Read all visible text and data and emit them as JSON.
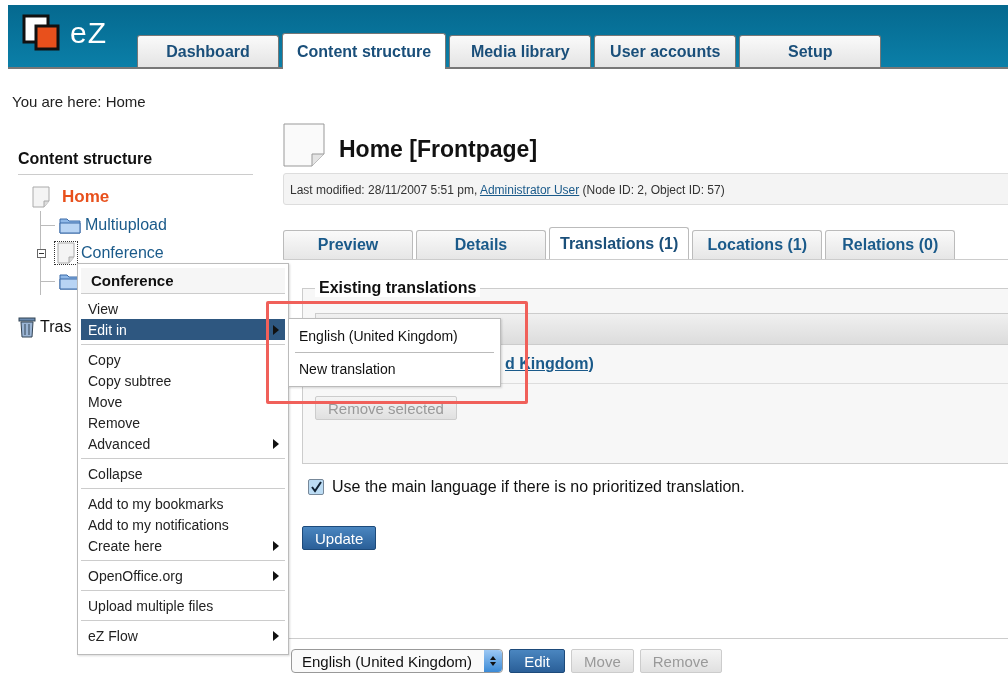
{
  "header": {
    "logo_text": "eZ",
    "tabs": [
      {
        "label": "Dashboard",
        "selected": false
      },
      {
        "label": "Content structure",
        "selected": true
      },
      {
        "label": "Media library",
        "selected": false
      },
      {
        "label": "User accounts",
        "selected": false
      },
      {
        "label": "Setup",
        "selected": false
      }
    ]
  },
  "breadcrumb": "You are here: Home",
  "sidebar": {
    "title": "Content structure",
    "tree": [
      {
        "label": "Home",
        "kind": "page",
        "selected": true,
        "children": [
          {
            "label": "Multiupload",
            "kind": "folder",
            "selected": false
          },
          {
            "label": "Conference",
            "kind": "page",
            "selected": false,
            "expanded": true
          },
          {
            "kind": "folder"
          }
        ]
      }
    ],
    "trash": "Tras"
  },
  "context_menu": {
    "title": "Conference",
    "sections": [
      [
        {
          "label": "View",
          "submenu": false,
          "highlighted": false
        },
        {
          "label": "Edit in",
          "submenu": true,
          "highlighted": true
        }
      ],
      [
        {
          "label": "Copy",
          "submenu": false,
          "highlighted": false
        },
        {
          "label": "Copy subtree",
          "submenu": false,
          "highlighted": false
        },
        {
          "label": "Move",
          "submenu": false,
          "highlighted": false
        },
        {
          "label": "Remove",
          "submenu": false,
          "highlighted": false
        },
        {
          "label": "Advanced",
          "submenu": true,
          "highlighted": false
        }
      ],
      [
        {
          "label": "Collapse",
          "submenu": false,
          "highlighted": false
        }
      ],
      [
        {
          "label": "Add to my bookmarks",
          "submenu": false,
          "highlighted": false
        },
        {
          "label": "Add to my notifications",
          "submenu": false,
          "highlighted": false
        },
        {
          "label": "Create here",
          "submenu": true,
          "highlighted": false
        }
      ],
      [
        {
          "label": "OpenOffice.org",
          "submenu": true,
          "highlighted": false
        }
      ],
      [
        {
          "label": "Upload multiple files",
          "submenu": false,
          "highlighted": false
        }
      ],
      [
        {
          "label": "eZ Flow",
          "submenu": true,
          "highlighted": false
        }
      ]
    ]
  },
  "submenu": {
    "items": [
      "English (United Kingdom)",
      "New translation"
    ]
  },
  "content": {
    "title": "Home [Frontpage]",
    "meta": {
      "before": "Last modified: 28/11/2007 5:51 pm, ",
      "link": "Administrator User",
      "after": " (Node ID: 2, Object ID: 57)"
    },
    "tabs": [
      {
        "label": "Preview",
        "selected": false
      },
      {
        "label": "Details",
        "selected": false
      },
      {
        "label": "Translations (1)",
        "selected": true
      },
      {
        "label": "Locations (1)",
        "selected": false
      },
      {
        "label": "Relations (0)",
        "selected": false
      }
    ],
    "translations": {
      "legend": "Existing translations",
      "link_fragment": "d Kingdom)",
      "remove_button": {
        "label": "Remove selected",
        "disabled": true
      }
    },
    "fallback": {
      "label": "Use the main language if there is no prioritized translation.",
      "checked": true
    },
    "update_button": "Update",
    "bottom_bar": {
      "language": "English (United Kingdom)",
      "buttons": [
        {
          "label": "Edit",
          "disabled": false
        },
        {
          "label": "Move",
          "disabled": true
        },
        {
          "label": "Remove",
          "disabled": true
        }
      ]
    }
  }
}
